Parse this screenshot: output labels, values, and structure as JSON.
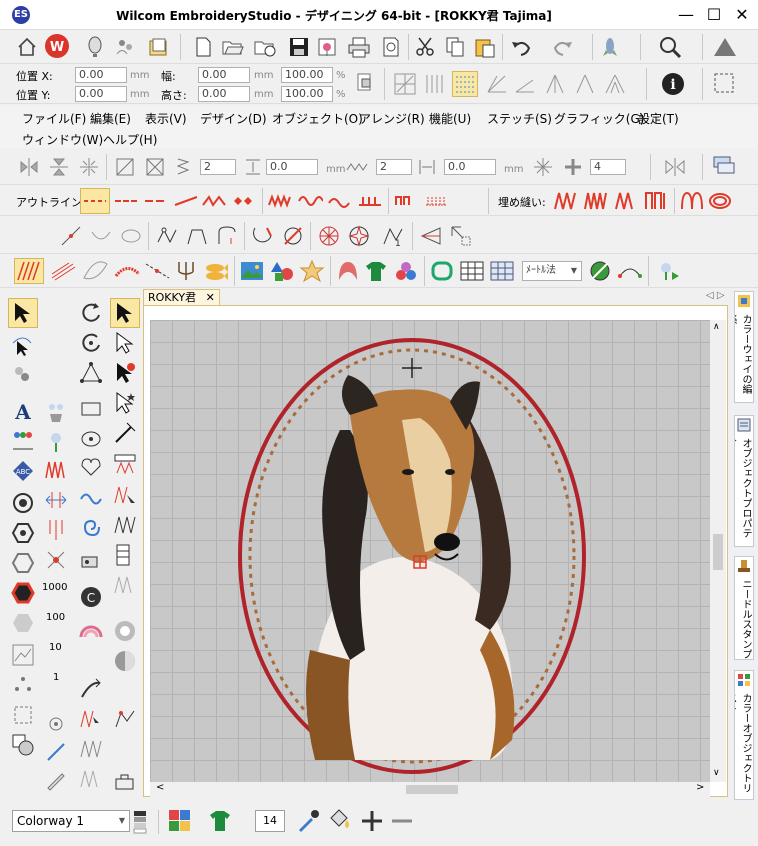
{
  "window": {
    "title": "Wilcom EmbroideryStudio - デザイニング 64-bit - [ROKKY君        Tajima]",
    "app_icon": "ES",
    "minimize": "—",
    "maximize": "☐",
    "close": "✕"
  },
  "coords": {
    "x_label": "位置 X:",
    "y_label": "位置 Y:",
    "x_value": "0.00",
    "y_value": "0.00",
    "width_label": "幅:",
    "height_label": "高さ:",
    "width_value": "0.00",
    "height_value": "0.00",
    "width_pct": "100.00",
    "height_pct": "100.00",
    "unit": "mm",
    "pct_unit": "%"
  },
  "menu": [
    "ファイル(F)",
    "編集(E)",
    "表示(V)",
    "デザイン(D)",
    "オブジェクト(O)",
    "アレンジ(R)",
    "機能(U)",
    "ステッチ(S)",
    "グラフィック(G)",
    "設定(T)",
    "ウィンドウ(W)",
    "ヘルプ(H)"
  ],
  "toolbar4": {
    "spin1": "2",
    "spin2": "0.0",
    "spin3": "2",
    "spin4": "0.0",
    "spin5": "4",
    "unit": "mm"
  },
  "stitch_bar": {
    "outline_label": "アウトライン:",
    "fill_label": "埋め縫い:"
  },
  "toolbar7": {
    "measure_label": "ﾒｰﾄﾙ法"
  },
  "document": {
    "tab_label": "ROKKY君",
    "tab_close": "✕"
  },
  "left_numbers": [
    "1000",
    "100",
    "10",
    "1"
  ],
  "right_tabs": [
    "カラーウェイの編集",
    "オブジェクトプロパティ",
    "ニードルスタンプ",
    "カラーオブジェクトリスト"
  ],
  "bottom": {
    "colorway": "Colorway 1",
    "number": "14"
  },
  "colors": {
    "accent_red": "#c0392b",
    "hoop_red": "#b0232a",
    "frame_gold": "#d8c080",
    "canvas_gray": "#c8c8c8"
  },
  "icons": [
    "home-icon",
    "wilcom-logo-icon",
    "balloon-icon",
    "new-icon",
    "open-icon",
    "save-icon",
    "print-icon",
    "cut-icon",
    "copy-icon",
    "paste-icon",
    "undo-icon",
    "redo-icon",
    "zoom-icon",
    "info-icon"
  ]
}
